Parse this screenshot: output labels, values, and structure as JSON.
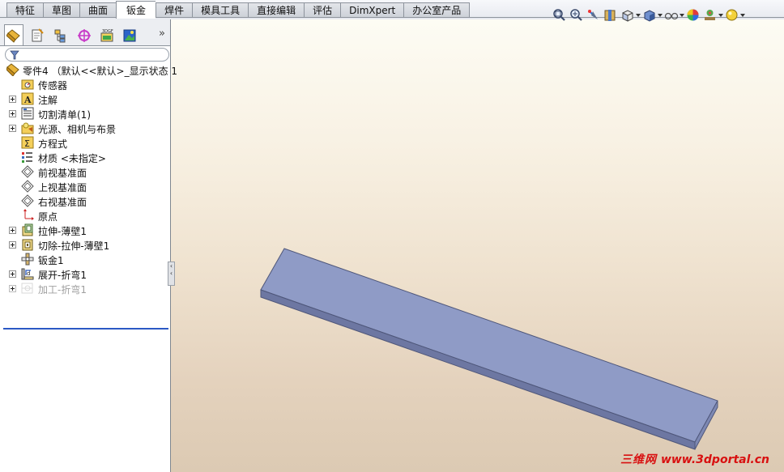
{
  "command_manager": {
    "tabs": [
      {
        "label": "特征",
        "active": false
      },
      {
        "label": "草图",
        "active": false
      },
      {
        "label": "曲面",
        "active": false
      },
      {
        "label": "钣金",
        "active": true
      },
      {
        "label": "焊件",
        "active": false
      },
      {
        "label": "模具工具",
        "active": false
      },
      {
        "label": "直接编辑",
        "active": false
      },
      {
        "label": "评估",
        "active": false
      },
      {
        "label": "DimXpert",
        "active": false
      },
      {
        "label": "办公室产品",
        "active": false
      }
    ]
  },
  "heads_up_toolbar": {
    "buttons": [
      {
        "icon": "zoom-to-fit-icon"
      },
      {
        "icon": "zoom-to-area-icon"
      },
      {
        "icon": "previous-view-icon"
      },
      {
        "icon": "section-view-icon"
      },
      {
        "icon": "view-orientation-icon",
        "dropdown": true
      },
      {
        "icon": "display-style-icon",
        "dropdown": true
      },
      {
        "icon": "hide-show-items-icon",
        "dropdown": true
      },
      {
        "icon": "edit-appearance-icon"
      },
      {
        "icon": "apply-scene-icon",
        "dropdown": true
      },
      {
        "icon": "view-settings-icon",
        "dropdown": true
      }
    ]
  },
  "feature_manager": {
    "panel_tabs": [
      {
        "icon": "feature-manager-tree-icon",
        "active": true
      },
      {
        "icon": "property-manager-icon"
      },
      {
        "icon": "configuration-manager-icon"
      },
      {
        "icon": "dimxpert-manager-icon"
      },
      {
        "icon": "display-manager-icon"
      },
      {
        "icon": "appearance-manager-icon"
      }
    ],
    "expand_glyph": "»",
    "filter_icon": "filter-icon",
    "root": {
      "label": "零件4  （默认<<默认>_显示状态 1",
      "icon": "part-icon"
    },
    "items": [
      {
        "label": "传感器",
        "icon": "sensors-folder-icon",
        "expandable": false
      },
      {
        "label": "注解",
        "icon": "annotations-icon",
        "expandable": true
      },
      {
        "label": "切割清单(1)",
        "icon": "cut-list-icon",
        "expandable": true
      },
      {
        "label": "光源、相机与布景",
        "icon": "lights-cameras-scene-icon",
        "expandable": true
      },
      {
        "label": "方程式",
        "icon": "equations-icon",
        "expandable": false
      },
      {
        "label": "材质 <未指定>",
        "icon": "material-icon",
        "expandable": false
      },
      {
        "label": "前视基准面",
        "icon": "plane-icon",
        "expandable": false
      },
      {
        "label": "上视基准面",
        "icon": "plane-icon",
        "expandable": false
      },
      {
        "label": "右视基准面",
        "icon": "plane-icon",
        "expandable": false
      },
      {
        "label": "原点",
        "icon": "origin-icon",
        "expandable": false
      },
      {
        "label": "拉伸-薄壁1",
        "icon": "extrude-thin-icon",
        "expandable": true
      },
      {
        "label": "切除-拉伸-薄壁1",
        "icon": "cut-extrude-thin-icon",
        "expandable": true
      },
      {
        "label": "钣金1",
        "icon": "sheet-metal-icon",
        "expandable": false
      },
      {
        "label": "展开-折弯1",
        "icon": "unfold-icon",
        "expandable": true
      },
      {
        "label": "加工-折弯1",
        "icon": "process-bends-icon",
        "expandable": true,
        "suppressed": true
      }
    ]
  },
  "viewport": {
    "part_face_color": "#8d99c4",
    "part_edge_color": "#5a6488"
  },
  "watermark": {
    "brand": "三维网",
    "url": "www.3dportal.cn"
  }
}
